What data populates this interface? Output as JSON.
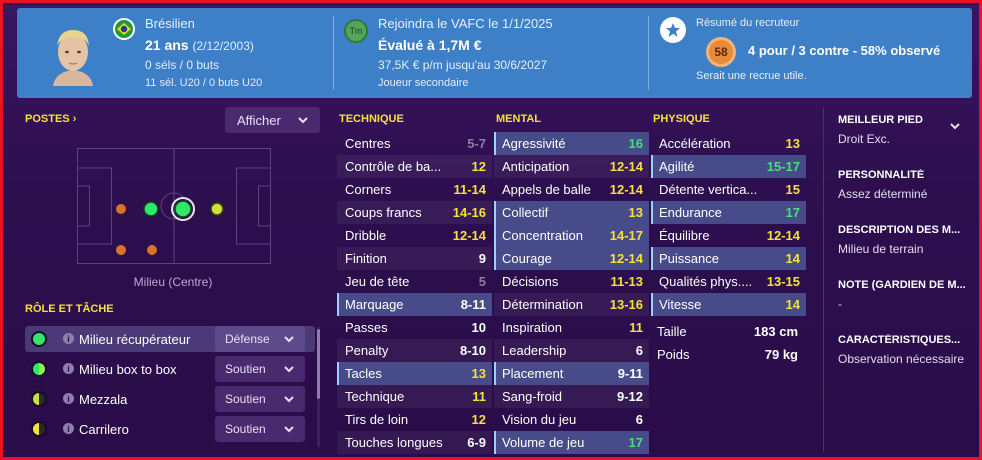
{
  "header": {
    "nationality": "Brésilien",
    "age": "21 ans",
    "dob": "(2/12/2003)",
    "selections": "0 séls / 0 buts",
    "u20": "11 sél. U20 / 0 buts U20",
    "tm_icon_text": "Tm",
    "join": "Rejoindra le VAFC le 1/1/2025",
    "value": "Évalué à 1,7M €",
    "wage": "37,5K € p/m jusqu'au 30/6/2027",
    "role": "Joueur secondaire",
    "scout_title": "Résumé du recruteur",
    "scout_rating": "58",
    "scout_summary": "4 pour / 3 contre - 58% observé",
    "scout_note": "Serait une recrue utile.",
    "colors": {
      "header_bg": "#3d80c7",
      "rating": "#e88a3a",
      "accent_yellow": "#f2e23a",
      "accent_green": "#45e07a"
    }
  },
  "positions": {
    "title": "POSTES",
    "show_button": "Afficher",
    "pitch_label": "Milieu (Centre)"
  },
  "roles": {
    "title": "RÔLE ET TÂCHE",
    "items": [
      {
        "name": "Milieu récupérateur",
        "duty": "Défense",
        "color": "#2ee86a"
      },
      {
        "name": "Milieu box to box",
        "duty": "Soutien",
        "color": "#3ae35e"
      },
      {
        "name": "Mezzala",
        "duty": "Soutien",
        "color": "#c9e23a"
      },
      {
        "name": "Carrilero",
        "duty": "Soutien",
        "color": "#f2e23a"
      }
    ]
  },
  "technique": {
    "title": "TECHNIQUE",
    "attrs": [
      {
        "name": "Centres",
        "value": "5-7"
      },
      {
        "name": "Contrôle de ba...",
        "value": "12"
      },
      {
        "name": "Corners",
        "value": "11-14"
      },
      {
        "name": "Coups francs",
        "value": "14-16"
      },
      {
        "name": "Dribble",
        "value": "12-14"
      },
      {
        "name": "Finition",
        "value": "9"
      },
      {
        "name": "Jeu de tête",
        "value": "5"
      },
      {
        "name": "Marquage",
        "value": "8-11"
      },
      {
        "name": "Passes",
        "value": "10"
      },
      {
        "name": "Penalty",
        "value": "8-10"
      },
      {
        "name": "Tacles",
        "value": "13"
      },
      {
        "name": "Technique",
        "value": "11"
      },
      {
        "name": "Tirs de loin",
        "value": "12"
      },
      {
        "name": "Touches longues",
        "value": "6-9"
      }
    ]
  },
  "mental": {
    "title": "MENTAL",
    "attrs": [
      {
        "name": "Agressivité",
        "value": "16"
      },
      {
        "name": "Anticipation",
        "value": "12-14"
      },
      {
        "name": "Appels de balle",
        "value": "12-14"
      },
      {
        "name": "Collectif",
        "value": "13"
      },
      {
        "name": "Concentration",
        "value": "14-17"
      },
      {
        "name": "Courage",
        "value": "12-14"
      },
      {
        "name": "Décisions",
        "value": "11-13"
      },
      {
        "name": "Détermination",
        "value": "13-16"
      },
      {
        "name": "Inspiration",
        "value": "11"
      },
      {
        "name": "Leadership",
        "value": "6"
      },
      {
        "name": "Placement",
        "value": "9-11"
      },
      {
        "name": "Sang-froid",
        "value": "9-12"
      },
      {
        "name": "Vision du jeu",
        "value": "6"
      },
      {
        "name": "Volume de jeu",
        "value": "17"
      }
    ]
  },
  "physique": {
    "title": "PHYSIQUE",
    "attrs": [
      {
        "name": "Accélération",
        "value": "13"
      },
      {
        "name": "Agilité",
        "value": "15-17"
      },
      {
        "name": "Détente vertica...",
        "value": "15"
      },
      {
        "name": "Endurance",
        "value": "17"
      },
      {
        "name": "Équilibre",
        "value": "12-14"
      },
      {
        "name": "Puissance",
        "value": "14"
      },
      {
        "name": "Qualités phys....",
        "value": "13-15"
      },
      {
        "name": "Vitesse",
        "value": "14"
      }
    ],
    "height_label": "Taille",
    "height_value": "183 cm",
    "weight_label": "Poids",
    "weight_value": "79 kg"
  },
  "info": {
    "foot_label": "MEILLEUR PIED",
    "foot_value": "Droit Exc.",
    "personality_label": "PERSONNALITÉ",
    "personality_value": "Assez déterminé",
    "description_label": "DESCRIPTION DES M...",
    "description_value": "Milieu de terrain",
    "gk_label": "NOTE (GARDIEN DE M...",
    "gk_value": "-",
    "traits_label": "CARACTÉRISTIQUES...",
    "traits_value": "Observation nécessaire"
  }
}
